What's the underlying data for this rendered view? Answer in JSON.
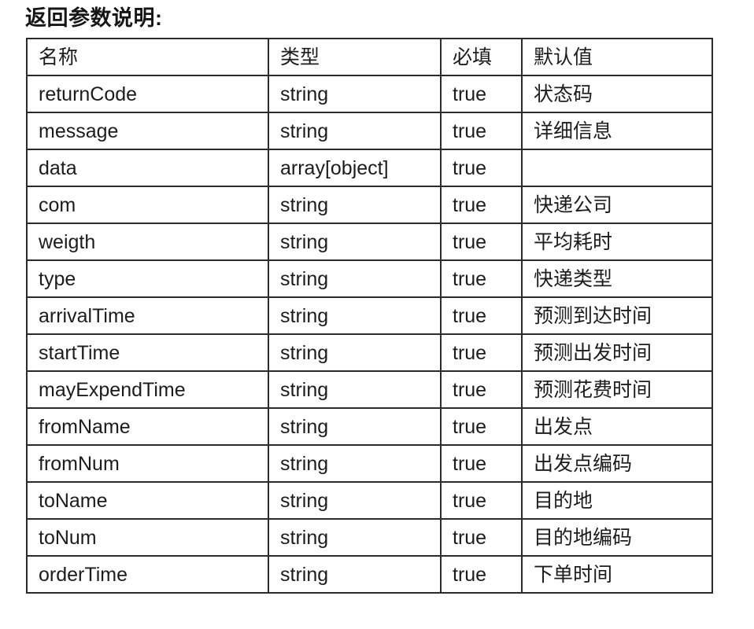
{
  "document": {
    "title": "返回参数说明:"
  },
  "table": {
    "name": "return-parameters-table",
    "columns": [
      {
        "key": "name",
        "label": "名称"
      },
      {
        "key": "type",
        "label": "类型"
      },
      {
        "key": "required",
        "label": "必填"
      },
      {
        "key": "default",
        "label": "默认值"
      }
    ],
    "rows": [
      {
        "name": "returnCode",
        "indent": 0,
        "type": "string",
        "required": "true",
        "default": "状态码"
      },
      {
        "name": "message",
        "indent": 0,
        "type": "string",
        "required": "true",
        "default": "详细信息"
      },
      {
        "name": "data",
        "indent": 0,
        "type": "array[object]",
        "required": "true",
        "default": ""
      },
      {
        "name": "com",
        "indent": 1,
        "type": "string",
        "required": "true",
        "default": "快递公司"
      },
      {
        "name": "weigth",
        "indent": 1,
        "type": "string",
        "required": "true",
        "default": "平均耗时"
      },
      {
        "name": "type",
        "indent": 1,
        "type": "string",
        "required": "true",
        "default": "快递类型"
      },
      {
        "name": "arrivalTime",
        "indent": 1,
        "type": "string",
        "required": "true",
        "default": "预测到达时间"
      },
      {
        "name": "startTime",
        "indent": 1,
        "type": "string",
        "required": "true",
        "default": "预测出发时间"
      },
      {
        "name": "mayExpendTime",
        "indent": 1,
        "type": "string",
        "required": "true",
        "default": "预测花费时间"
      },
      {
        "name": "fromName",
        "indent": 0,
        "type": "string",
        "required": "true",
        "default": "出发点"
      },
      {
        "name": "fromNum",
        "indent": 0,
        "type": "string",
        "required": "true",
        "default": "出发点编码"
      },
      {
        "name": "toName",
        "indent": 0,
        "type": "string",
        "required": "true",
        "default": "目的地"
      },
      {
        "name": "toNum",
        "indent": 0,
        "type": "string",
        "required": "true",
        "default": "目的地编码"
      },
      {
        "name": "orderTime",
        "indent": 0,
        "type": "string",
        "required": "true",
        "default": "下单时间"
      }
    ]
  },
  "style": {
    "border_color": "#2b2b2b",
    "text_color": "#1c1c1c",
    "background": "#ffffff"
  }
}
